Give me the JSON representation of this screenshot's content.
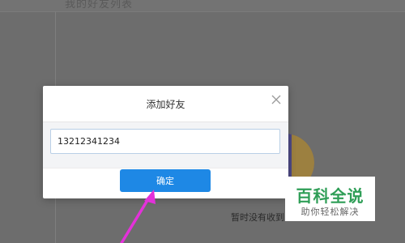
{
  "background": {
    "top_text": "我的好友列表",
    "empty_text": "暂时没有收到"
  },
  "dialog": {
    "title": "添加好友",
    "close_icon": "close-icon",
    "input_value": "13212341234",
    "confirm_label": "确定"
  },
  "annotation": {
    "arrow_color": "#e331d9"
  },
  "watermark": {
    "main": "百科全说",
    "sub": "助你轻松解决"
  },
  "colors": {
    "accent": "#1e88e5",
    "overlay": "#6d6d6d",
    "watermark_green": "#2f9e57"
  }
}
